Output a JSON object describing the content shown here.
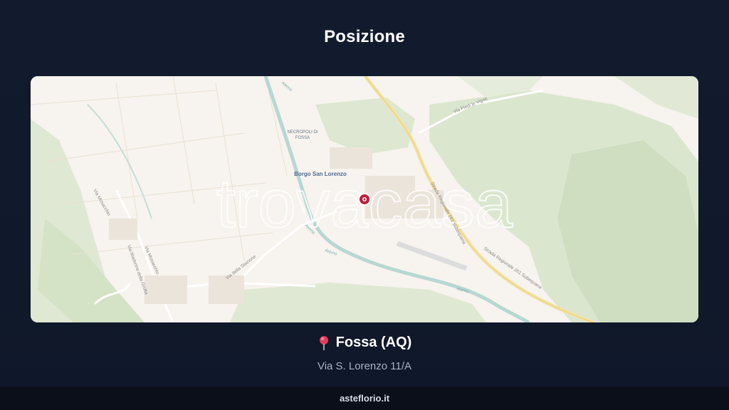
{
  "header": {
    "title": "Posizione"
  },
  "map": {
    "watermark": "trovacasa",
    "labels": {
      "borgo": "Borgo San Lorenzo",
      "necropoli_1": "NECROPOLI DI",
      "necropoli_2": "FOSSA",
      "strada_1": "Strada Regionale 261 Subequana",
      "strada_2": "Strada Regionale 261 Subequana",
      "via_stazione": "Via della Stazione",
      "via_madonna": "Via Madonna della Grotta",
      "via_mosacchio": "Via Mosacchio",
      "via_mosacchio_2": "Via Mosacchio",
      "via_piedi": "Via Piedi le Vigne",
      "aterno_1": "Aterno",
      "aterno_2": "Aterno",
      "aterno_3": "Aterno",
      "aterno_4": "Aterno"
    },
    "marker_icon": "map-pin-marker-icon"
  },
  "location": {
    "pin_icon": "pushpin-icon",
    "name": "Fossa (AQ)",
    "address": "Via S. Lorenzo 11/A"
  },
  "footer": {
    "site": "asteflorio.it"
  }
}
